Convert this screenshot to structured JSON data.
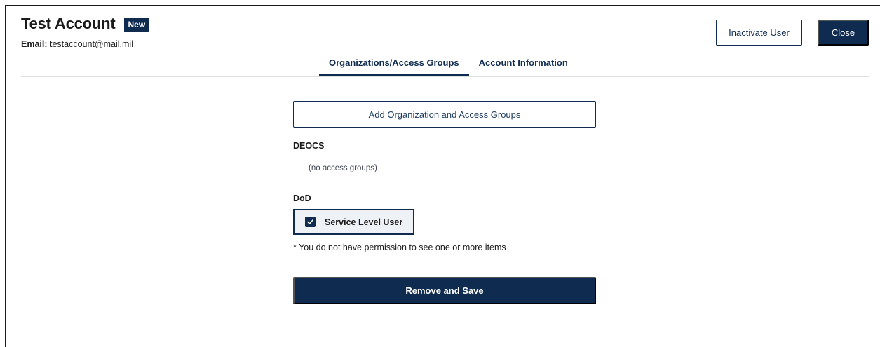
{
  "header": {
    "title": "Test Account",
    "badge": "New",
    "email_label": "Email:",
    "email_value": "testaccount@mail.mil",
    "inactivate_label": "Inactivate User",
    "close_label": "Close"
  },
  "tabs": [
    {
      "label": "Organizations/Access Groups",
      "active": true
    },
    {
      "label": "Account Information",
      "active": false
    }
  ],
  "main": {
    "add_button_label": "Add Organization and Access Groups",
    "organizations": [
      {
        "name": "DEOCS",
        "empty_text": "(no access groups)"
      },
      {
        "name": "DoD",
        "groups": [
          {
            "label": "Service Level User",
            "checked": true
          }
        ]
      }
    ],
    "permission_note": "* You do not have permission to see one or more items",
    "save_button_label": "Remove and Save"
  },
  "colors": {
    "primary": "#0f2b4f",
    "chip_background": "#eef1f5",
    "divider": "#dcdee0"
  },
  "icons": {
    "checkbox": "check-icon"
  }
}
